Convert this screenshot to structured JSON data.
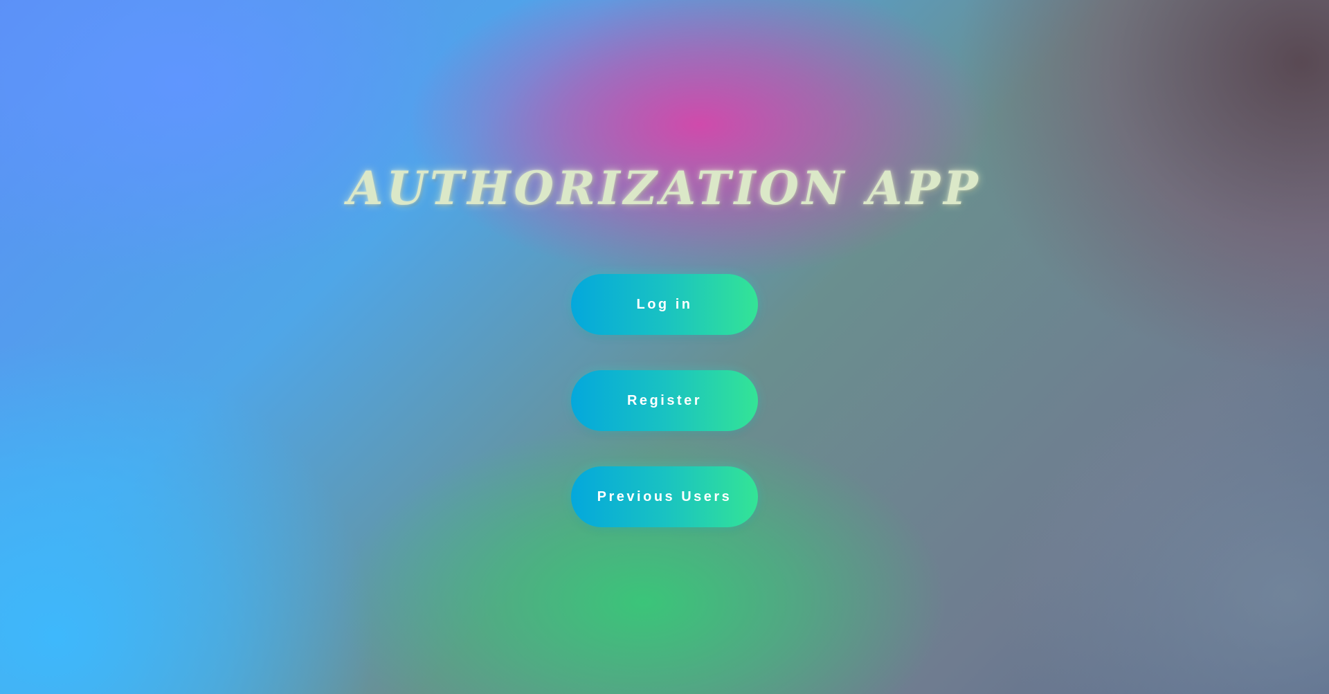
{
  "app": {
    "title": "AUTHORIZATION APP"
  },
  "menu": {
    "buttons": [
      {
        "label": "Log in"
      },
      {
        "label": "Register"
      },
      {
        "label": "Previous Users"
      }
    ]
  },
  "colors": {
    "button_gradient_start": "#04a8dc",
    "button_gradient_end": "#34e496",
    "title_color": "#dbe8c8",
    "button_text": "#ffffff"
  }
}
